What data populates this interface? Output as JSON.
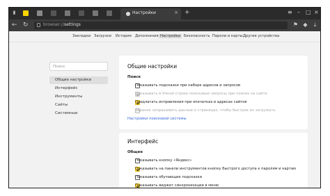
{
  "window": {
    "tab_title": "Настройки",
    "url_host": "browser://",
    "url_path": "settings"
  },
  "topnav": [
    "Закладки",
    "Загрузки",
    "История",
    "Дополнения",
    "Настройки",
    "Безопасность",
    "Пароли и карты",
    "Другие устройства"
  ],
  "sidebar": {
    "search_placeholder": "Поиск",
    "items": [
      "Общие настройки",
      "Интерфейс",
      "Инструменты",
      "Сайты",
      "Системные"
    ]
  },
  "general": {
    "title": "Общие настройки",
    "search_heading": "Поиск",
    "options": [
      {
        "label": "Показывать подсказки при наборе адресов и запросов",
        "checked": false,
        "disabled": false
      },
      {
        "label": "Показывать в Умной строке поисковые запросы при поиске на сайте",
        "checked": true,
        "disabled": true
      },
      {
        "label": "Предлагать исправления при опечатках в адресах сайтов",
        "checked": true,
        "disabled": false
      },
      {
        "label": "Заранее запрашивать данные о страницах, чтобы быстрее их загружать",
        "checked": false,
        "disabled": true
      }
    ],
    "link": "Настройки поисковой системы"
  },
  "interface": {
    "title": "Интерфейс",
    "heading": "Общее",
    "options": [
      {
        "label": "Показывать кнопку «Яндекс»",
        "checked": false
      },
      {
        "label": "Показывать на панели инструментов кнопку быстрого доступа к паролям и картам",
        "checked": true
      },
      {
        "label": "Показывать обучающие подсказки",
        "checked": false
      },
      {
        "label": "Показывать виджет синхронизации в меню",
        "checked": true
      }
    ]
  }
}
